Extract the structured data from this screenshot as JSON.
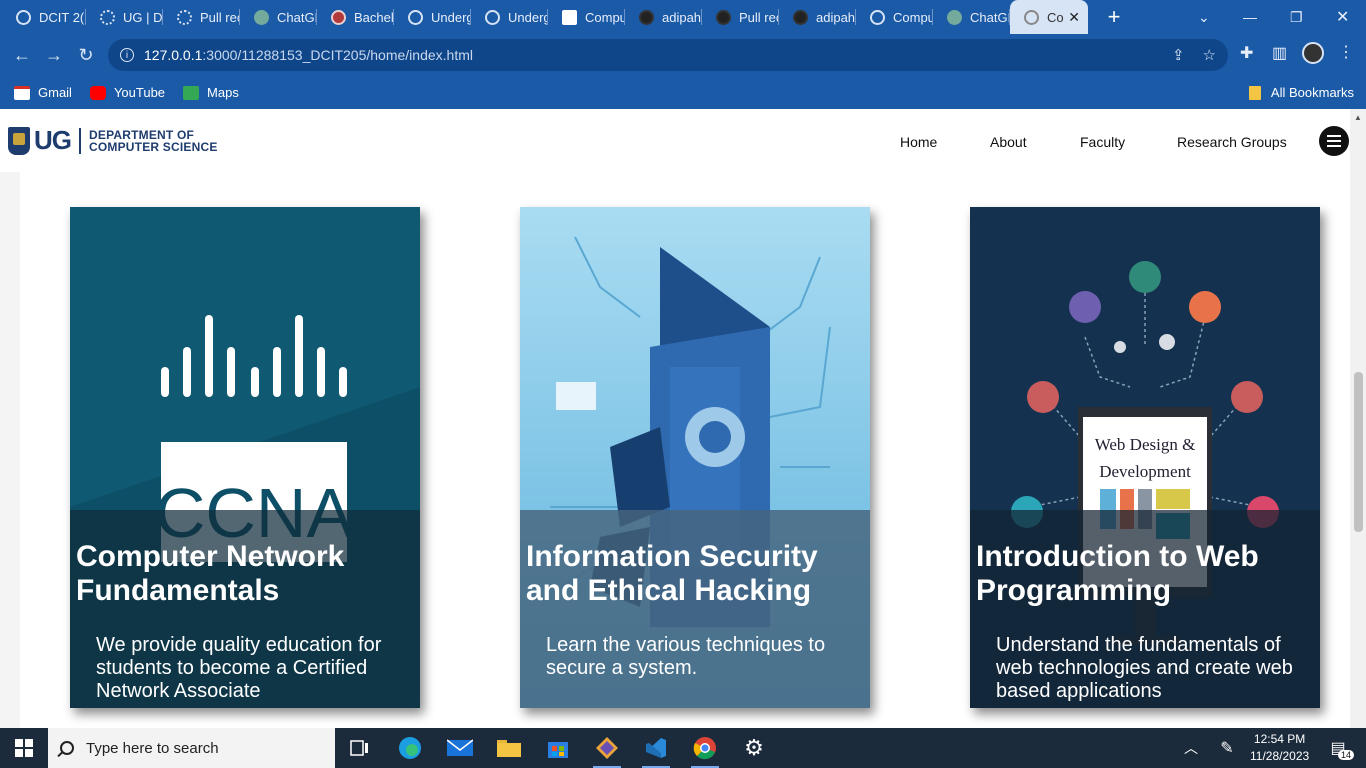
{
  "browser": {
    "tabs": [
      {
        "label": "DCIT 2(",
        "icon": "site-icon"
      },
      {
        "label": "UG | D",
        "icon": "loading-icon"
      },
      {
        "label": "Pull rec",
        "icon": "loading-icon"
      },
      {
        "label": "ChatGF",
        "icon": "chatgpt-icon"
      },
      {
        "label": "Bachel",
        "icon": "site-icon"
      },
      {
        "label": "Underg",
        "icon": "site-icon"
      },
      {
        "label": "Underg",
        "icon": "site-icon"
      },
      {
        "label": "Compu",
        "icon": "site-icon"
      },
      {
        "label": "adipah",
        "icon": "github-icon"
      },
      {
        "label": "Pull rec",
        "icon": "github-icon"
      },
      {
        "label": "adipah",
        "icon": "github-icon"
      },
      {
        "label": "Compu",
        "icon": "site-icon"
      },
      {
        "label": "ChatGF",
        "icon": "chatgpt-icon"
      },
      {
        "label": "Co",
        "icon": "site-icon"
      }
    ],
    "url_host": "127.0.0.1",
    "url_rest": ":3000/11288153_DCIT205/home/index.html",
    "bookmarks": [
      {
        "label": "Gmail",
        "color": "#d93025"
      },
      {
        "label": "YouTube",
        "color": "#ff0000"
      },
      {
        "label": "Maps",
        "color": "#34a853"
      }
    ],
    "all_bookmarks": "All Bookmarks"
  },
  "site": {
    "logo_ug": "UG",
    "logo_dept_line1": "DEPARTMENT OF",
    "logo_dept_line2": "COMPUTER SCIENCE",
    "nav": [
      "Home",
      "About",
      "Faculty",
      "Research Groups"
    ]
  },
  "cards": [
    {
      "title": "Computer Network Fundamentals",
      "description": "We provide quality education for students to become a Certified Network Associate",
      "image_text": "CCNA"
    },
    {
      "title": "Information Security and Ethical Hacking",
      "description": "Learn the various techniques to secure a system."
    },
    {
      "title": "Introduction to Web Programming",
      "description": "Understand the fundamentals of web technologies and create web based applications",
      "image_text_line1": "Web Design &",
      "image_text_line2": "Development"
    }
  ],
  "taskbar": {
    "search_placeholder": "Type here to search",
    "time": "12:54 PM",
    "date": "11/28/2023",
    "notification_count": "14"
  }
}
